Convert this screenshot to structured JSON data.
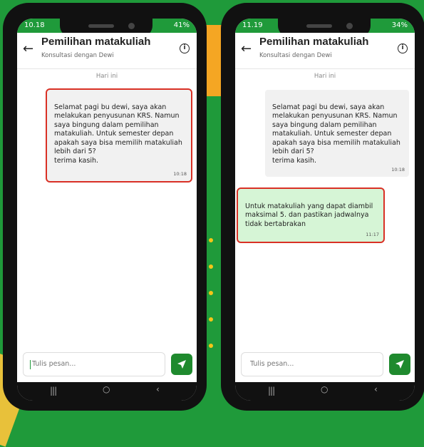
{
  "left_phone": {
    "status": {
      "time": "10.18",
      "battery": "41%"
    },
    "header": {
      "back": "←",
      "title": "Pemilihan matakuliah",
      "subtitle": "Konsultasi dengan Dewi",
      "info": "i"
    },
    "date_label": "Hari ini",
    "messages": [
      {
        "text": "Selamat pagi bu dewi, saya akan melakukan penyusunan KRS. Namun saya bingung dalam pemilihan matakuliah. Untuk semester depan apakah saya bisa memilih matakuliah lebih dari 5?\nterima kasih.",
        "time": "10:18"
      }
    ],
    "input": {
      "placeholder": "Tulis pesan..."
    },
    "nav": {
      "recents": "|||",
      "home": "○",
      "back": "‹"
    }
  },
  "right_phone": {
    "status": {
      "time": "11.19",
      "battery": "34%"
    },
    "header": {
      "back": "←",
      "title": "Pemilihan matakuliah",
      "subtitle": "Konsultasi dengan Dewi",
      "info": "i"
    },
    "date_label": "Hari ini",
    "messages": [
      {
        "text": "Selamat pagi bu dewi, saya akan melakukan penyusunan KRS. Namun saya bingung dalam pemilihan matakuliah. Untuk semester depan apakah saya bisa memilih matakuliah lebih dari 5?\nterima kasih.",
        "time": "10:18"
      },
      {
        "text": "Untuk matakuliah yang dapat diambil maksimal 5. dan pastikan jadwalnya tidak bertabrakan",
        "time": "11:17"
      }
    ],
    "input": {
      "placeholder": "Tulis pesan..."
    },
    "nav": {
      "recents": "|||",
      "home": "○",
      "back": "‹"
    }
  },
  "colors": {
    "brand_green": "#1f9a3a",
    "highlight_red": "#d93025",
    "received_bubble": "#d6f5d6"
  }
}
